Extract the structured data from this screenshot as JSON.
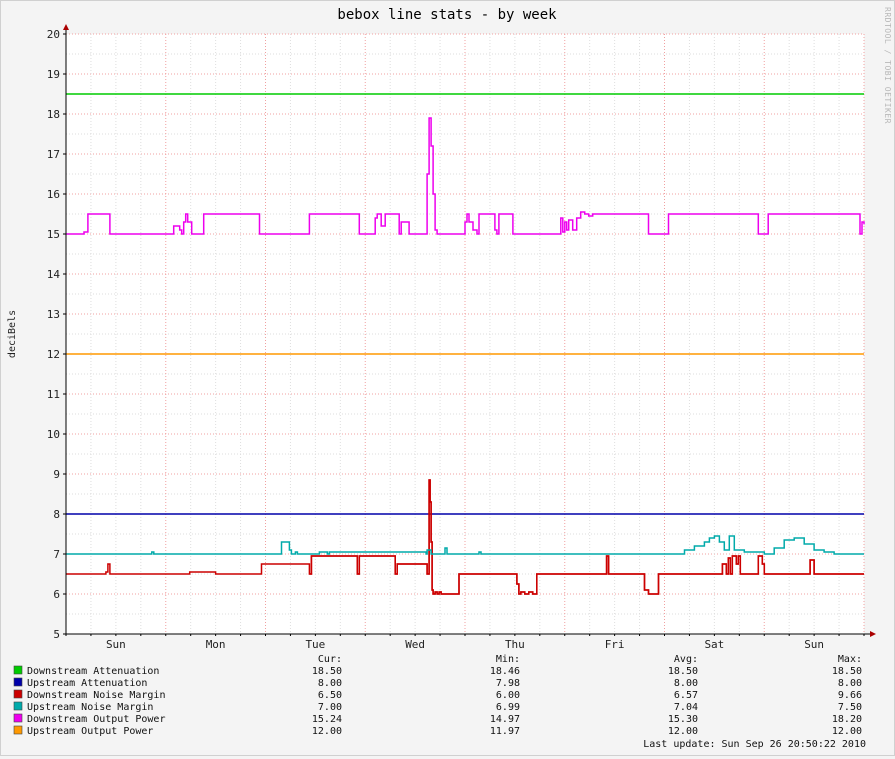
{
  "chart_data": {
    "type": "line",
    "title": "bebox line stats - by week",
    "ylabel": "deciBels",
    "side_label": "RRDTOOL / TOBI OETIKER",
    "ylim": [
      5,
      20
    ],
    "yticks": [
      5,
      6,
      7,
      8,
      9,
      10,
      11,
      12,
      13,
      14,
      15,
      16,
      17,
      18,
      19,
      20
    ],
    "x_range": [
      0,
      8
    ],
    "x_unit": "days",
    "xtick_labels": [
      {
        "label": "Sun",
        "x": 0.5
      },
      {
        "label": "Mon",
        "x": 1.5
      },
      {
        "label": "Tue",
        "x": 2.5
      },
      {
        "label": "Wed",
        "x": 3.5
      },
      {
        "label": "Thu",
        "x": 4.5
      },
      {
        "label": "Fri",
        "x": 5.5
      },
      {
        "label": "Sat",
        "x": 6.5
      },
      {
        "label": "Sun",
        "x": 7.5
      }
    ],
    "grid": true,
    "legend_position": "bottom",
    "series": [
      {
        "name": "Downstream Attenuation",
        "color": "#00cc00",
        "x": [
          0,
          8
        ],
        "y": [
          18.5,
          18.5
        ]
      },
      {
        "name": "Upstream Attenuation",
        "color": "#0000aa",
        "x": [
          0,
          8
        ],
        "y": [
          8.0,
          8.0
        ]
      },
      {
        "name": "Downstream Noise Margin",
        "color": "#cc0000",
        "x": [
          0,
          0.38,
          0.4,
          0.42,
          0.44,
          1.2,
          1.24,
          1.5,
          1.52,
          1.94,
          1.96,
          2.44,
          2.46,
          2.92,
          2.94,
          3.3,
          3.32,
          3.62,
          3.64,
          3.65,
          3.66,
          3.67,
          3.68,
          3.7,
          3.72,
          3.74,
          3.76,
          3.94,
          3.96,
          4.0,
          4.02,
          4.52,
          4.54,
          4.56,
          4.6,
          4.64,
          4.68,
          4.7,
          4.72,
          4.94,
          4.96,
          5.42,
          5.44,
          5.78,
          5.8,
          5.84,
          5.92,
          5.94,
          6.56,
          6.58,
          6.62,
          6.64,
          6.66,
          6.68,
          6.72,
          6.74,
          6.76,
          6.92,
          6.94,
          6.98,
          7.0,
          7.44,
          7.46,
          7.5,
          7.52,
          7.88,
          7.9,
          8.0
        ],
        "y": [
          6.5,
          6.5,
          6.55,
          6.75,
          6.5,
          6.5,
          6.55,
          6.5,
          6.5,
          6.5,
          6.75,
          6.5,
          6.95,
          6.5,
          6.95,
          6.5,
          6.75,
          6.5,
          8.85,
          8.3,
          7.3,
          6.1,
          6.0,
          6.05,
          6.0,
          6.05,
          6.0,
          6.5,
          6.5,
          6.5,
          6.5,
          6.25,
          6.0,
          6.05,
          6.0,
          6.05,
          6.0,
          6.0,
          6.5,
          6.5,
          6.5,
          6.95,
          6.5,
          6.5,
          6.1,
          6.0,
          6.0,
          6.5,
          6.5,
          6.75,
          6.5,
          6.9,
          6.5,
          6.95,
          6.75,
          6.95,
          6.5,
          6.5,
          6.95,
          6.75,
          6.5,
          6.5,
          6.85,
          6.5,
          6.5,
          6.5,
          6.5,
          6.5
        ]
      },
      {
        "name": "Downstream Noise Margin",
        "color": "#cc0000",
        "x": [
          2.44,
          2.46,
          2.92,
          2.94,
          3.3,
          3.32,
          3.62,
          3.64,
          3.65,
          3.66,
          3.67,
          3.68,
          3.7,
          3.72,
          3.74,
          3.76,
          3.94,
          3.96,
          4.0,
          4.02,
          4.52,
          4.54,
          4.56,
          4.6,
          4.64,
          4.68,
          4.7,
          4.72,
          4.94,
          4.96,
          5.42,
          5.44,
          5.78,
          5.8,
          5.84,
          5.92,
          5.94,
          6.56,
          6.58,
          6.62,
          6.64,
          6.66,
          6.68,
          6.72,
          6.74,
          6.76,
          6.92,
          6.94,
          6.98,
          7.0,
          7.44,
          7.46,
          7.5,
          7.52,
          7.88,
          7.9,
          8.0
        ],
        "y": [
          6.5,
          6.95,
          6.5,
          6.95,
          6.5,
          6.75,
          6.5,
          8.85,
          8.3,
          7.3,
          6.1,
          6.0,
          6.05,
          6.0,
          6.05,
          6.0,
          6.5,
          6.5,
          6.5,
          6.5,
          6.25,
          6.0,
          6.05,
          6.0,
          6.05,
          6.0,
          6.0,
          6.5,
          6.5,
          6.5,
          6.95,
          6.5,
          6.5,
          6.1,
          6.0,
          6.0,
          6.5,
          6.5,
          6.75,
          6.5,
          6.9,
          6.5,
          6.95,
          6.75,
          6.95,
          6.5,
          6.5,
          6.95,
          6.75,
          6.5,
          6.5,
          6.85,
          6.5,
          6.5,
          6.5,
          6.5,
          6.5
        ]
      },
      {
        "name": "Upstream Noise Margin",
        "color": "#00aaaa",
        "x": [
          0,
          0.84,
          0.86,
          0.88,
          2.14,
          2.16,
          2.24,
          2.26,
          2.3,
          2.32,
          2.52,
          2.54,
          2.6,
          2.62,
          2.64,
          3.61,
          3.62,
          3.66,
          3.68,
          3.8,
          3.82,
          4.14,
          4.16,
          6.1,
          6.2,
          6.3,
          6.4,
          6.45,
          6.5,
          6.55,
          6.6,
          6.65,
          6.7,
          6.8,
          6.9,
          7.0,
          7.1,
          7.2,
          7.3,
          7.4,
          7.5,
          7.6,
          7.7,
          7.8,
          8.0
        ],
        "y": [
          7.0,
          7.0,
          7.05,
          7.0,
          7.0,
          7.3,
          7.1,
          7.0,
          7.05,
          7.0,
          7.0,
          7.05,
          7.05,
          7.0,
          7.05,
          7.0,
          7.1,
          7.0,
          7.0,
          7.15,
          7.0,
          7.05,
          7.0,
          7.0,
          7.1,
          7.2,
          7.3,
          7.4,
          7.45,
          7.3,
          7.1,
          7.45,
          7.1,
          7.05,
          7.05,
          7.0,
          7.15,
          7.35,
          7.4,
          7.25,
          7.1,
          7.05,
          7.0,
          7.0,
          7.0
        ]
      },
      {
        "name": "Downstream Output Power",
        "color": "#ee00ee",
        "x": [
          0,
          0.18,
          0.22,
          0.42,
          0.44,
          1.06,
          1.08,
          1.14,
          1.16,
          1.18,
          1.2,
          1.22,
          1.26,
          1.36,
          1.38,
          1.92,
          1.94,
          2.42,
          2.44,
          2.92,
          2.94,
          3.08,
          3.1,
          3.12,
          3.16,
          3.2,
          3.34,
          3.36,
          3.44,
          3.46,
          3.6,
          3.62,
          3.64,
          3.66,
          3.68,
          3.7,
          3.72,
          3.98,
          4.0,
          4.02,
          4.04,
          4.08,
          4.12,
          4.14,
          4.16,
          4.3,
          4.32,
          4.34,
          4.36,
          4.48,
          4.5,
          4.94,
          4.96,
          4.98,
          5.0,
          5.02,
          5.04,
          5.08,
          5.12,
          5.16,
          5.2,
          5.24,
          5.28,
          5.4,
          5.42,
          5.84,
          5.86,
          6.0,
          6.04,
          6.32,
          6.34,
          6.92,
          6.94,
          7.0,
          7.04,
          7.94,
          7.96,
          7.98,
          8.0
        ],
        "y": [
          15.0,
          15.05,
          15.5,
          15.5,
          15.0,
          15.0,
          15.2,
          15.1,
          15.0,
          15.3,
          15.5,
          15.3,
          15.0,
          15.0,
          15.5,
          15.5,
          15.0,
          15.0,
          15.5,
          15.5,
          15.0,
          15.0,
          15.4,
          15.5,
          15.2,
          15.5,
          15.0,
          15.3,
          15.0,
          15.0,
          15.0,
          16.5,
          17.9,
          17.2,
          16.0,
          15.1,
          15.0,
          15.0,
          15.3,
          15.5,
          15.3,
          15.1,
          15.0,
          15.5,
          15.5,
          15.1,
          15.0,
          15.5,
          15.5,
          15.0,
          15.0,
          15.0,
          15.4,
          15.05,
          15.3,
          15.1,
          15.35,
          15.1,
          15.4,
          15.55,
          15.5,
          15.45,
          15.5,
          15.5,
          15.5,
          15.0,
          15.0,
          15.0,
          15.5,
          15.5,
          15.5,
          15.5,
          15.0,
          15.0,
          15.5,
          15.5,
          15.0,
          15.3,
          15.24
        ]
      },
      {
        "name": "Upstream Output Power",
        "color": "#ff9900",
        "x": [
          0,
          8
        ],
        "y": [
          12.0,
          12.0
        ]
      }
    ]
  },
  "legend": {
    "headers": {
      "cur": "Cur:",
      "min": "Min:",
      "avg": "Avg:",
      "max": "Max:"
    },
    "rows": [
      {
        "name": "Downstream Attenuation",
        "color": "#00cc00",
        "cur": "18.50",
        "min": "18.46",
        "avg": "18.50",
        "max": "18.50"
      },
      {
        "name": "Upstream Attenuation",
        "color": "#0000aa",
        "cur": "8.00",
        "min": "7.98",
        "avg": "8.00",
        "max": "8.00"
      },
      {
        "name": "Downstream Noise Margin",
        "color": "#cc0000",
        "cur": "6.50",
        "min": "6.00",
        "avg": "6.57",
        "max": "9.66"
      },
      {
        "name": "Upstream Noise Margin",
        "color": "#00aaaa",
        "cur": "7.00",
        "min": "6.99",
        "avg": "7.04",
        "max": "7.50"
      },
      {
        "name": "Downstream Output Power",
        "color": "#ee00ee",
        "cur": "15.24",
        "min": "14.97",
        "avg": "15.30",
        "max": "18.20"
      },
      {
        "name": "Upstream Output Power",
        "color": "#ff9900",
        "cur": "12.00",
        "min": "11.97",
        "avg": "12.00",
        "max": "12.00"
      }
    ]
  },
  "last_update": "Last update: Sun Sep 26 20:50:22 2010"
}
